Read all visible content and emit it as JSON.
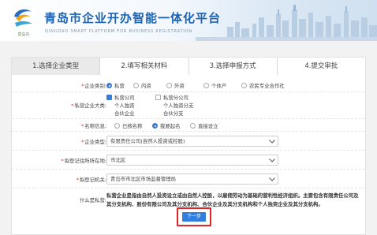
{
  "header": {
    "logo_caption": "莫岛办",
    "title": "青岛市企业开办智能一体化平台",
    "subtitle": "QINGDAO SMART PLATFORM FOR BUSINESS REGISTRATION"
  },
  "steps": [
    {
      "label": "1.选择企业类型",
      "active": true
    },
    {
      "label": "2.填写相关材料",
      "active": false
    },
    {
      "label": "3.选择申报方式",
      "active": false
    },
    {
      "label": "4.提交审批",
      "active": false
    }
  ],
  "form": {
    "company_category": {
      "label": "企业类别:",
      "options": [
        "私营",
        "内资",
        "外资",
        "个体户",
        "农民专业合作社"
      ],
      "selected": "私营"
    },
    "private_category": {
      "label": "私营企业大类:",
      "options": [
        "私营公司",
        "个人独资",
        "合伙企业",
        "私营分公司",
        "个人独资分支",
        "合伙分支"
      ],
      "checked": [
        "私营公司"
      ]
    },
    "name_info": {
      "label": "名称信息:",
      "options": [
        "已核名称",
        "我要起名",
        "直接设立"
      ],
      "selected": "我要起名"
    },
    "company_type": {
      "label": "企业类型:",
      "value": "有限责任公司(自然人投资或控股)"
    },
    "registration_location": {
      "label": "拟登记住所所在地:",
      "value": "市北区"
    },
    "registration_authority": {
      "label": "拟登记机关:",
      "value": "青岛市市北区市场监督管理局"
    },
    "definition": {
      "label": "什么是私营:",
      "text": "私营企业是指由自然人投资设立或由自然人控股，以雇佣劳动为基础的营利性经济组织。主要包含有限责任公司及其分支机构、股份有限公司及其分支机构、合伙企业及其分支机构和个人独资企业及其分支机构。"
    }
  },
  "next_button": "下一步",
  "colors": {
    "brand_blue": "#1b63b3",
    "radio_selected": "#3b7bd4",
    "button_blue": "#2f7ee0",
    "highlight_red": "#e0242a",
    "required_star": "#e3262c"
  }
}
